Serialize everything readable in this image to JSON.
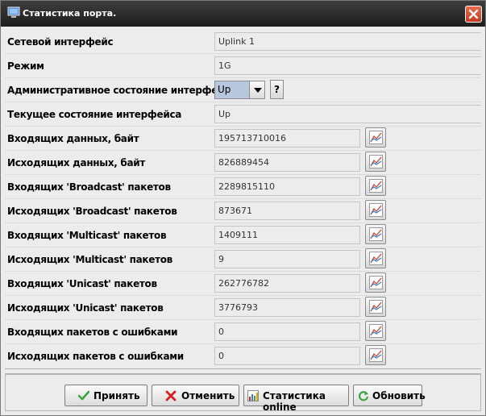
{
  "window": {
    "title": "Статистика порта."
  },
  "rows": [
    {
      "label": "Сетевой интерфейс",
      "value": "Uplink 1"
    },
    {
      "label": "Режим",
      "value": "1G"
    },
    {
      "label": "Административное состояние интерфейса",
      "value": "Up",
      "help": "?"
    },
    {
      "label": "Текущее состояние интерфейса",
      "value": "Up"
    },
    {
      "label": "Входящих данных, байт",
      "value": "195713710016"
    },
    {
      "label": "Исходящих данных, байт",
      "value": "826889454"
    },
    {
      "label": "Входящих 'Broadcast' пакетов",
      "value": "2289815110"
    },
    {
      "label": "Исходящих 'Broadcast' пакетов",
      "value": "873671"
    },
    {
      "label": "Входящих 'Multicast' пакетов",
      "value": "1409111"
    },
    {
      "label": "Исходящих 'Multicast' пакетов",
      "value": "9"
    },
    {
      "label": "Входящих 'Unicast' пакетов",
      "value": "262776782"
    },
    {
      "label": "Исходящих 'Unicast' пакетов",
      "value": "3776793"
    },
    {
      "label": "Входящих пакетов с ошибками",
      "value": "0"
    },
    {
      "label": "Исходящих пакетов с ошибками",
      "value": "0"
    }
  ],
  "buttons": {
    "accept": "Принять",
    "cancel": "Отменить",
    "stats_online": "Статистика online",
    "refresh": "Обновить"
  },
  "icons": {
    "app": "monitor-icon",
    "close": "close-icon",
    "chart": "chart-icon",
    "accept": "checkmark-icon",
    "cancel": "cross-icon",
    "stats": "bar-chart-icon",
    "refresh": "refresh-icon"
  },
  "colors": {
    "titlebar": "#2a2a2a",
    "close_button": "#d4502f",
    "selection": "#b7c7de",
    "accept_icon": "#3aa640",
    "cancel_icon": "#d62020"
  }
}
